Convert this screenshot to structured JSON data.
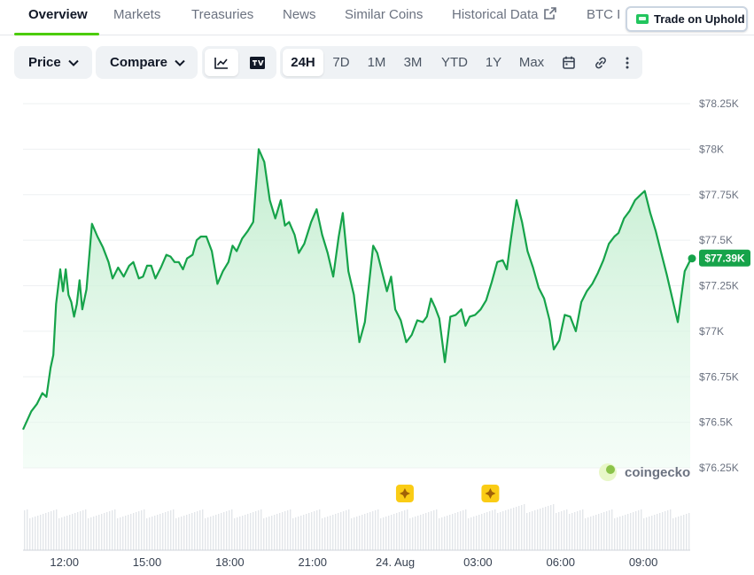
{
  "tabs": [
    {
      "label": "Overview",
      "active": true
    },
    {
      "label": "Markets"
    },
    {
      "label": "Treasuries"
    },
    {
      "label": "News"
    },
    {
      "label": "Similar Coins"
    },
    {
      "label": "Historical Data"
    },
    {
      "label": "BTC I"
    }
  ],
  "trade_button": {
    "label": "Trade on Uphold"
  },
  "toolbar": {
    "price_label": "Price",
    "compare_label": "Compare",
    "chart_type_icons": [
      "line-chart-icon",
      "tradingview-icon"
    ],
    "ranges": [
      "24H",
      "7D",
      "1M",
      "3M",
      "YTD",
      "1Y",
      "Max"
    ],
    "selected_range": "24H",
    "action_icons": [
      "calendar-icon",
      "link-icon",
      "more-icon"
    ]
  },
  "colors": {
    "accent": "#4bcc00",
    "line": "#16a34a",
    "fill": "#d6f5df",
    "event_marker": "#facc15"
  },
  "watermark": "coingecko",
  "current_price_label": "$77.39K",
  "chart_data": {
    "type": "area",
    "title": "",
    "xlabel": "",
    "ylabel": "",
    "ylim": [
      76180,
      78280
    ],
    "x_ticks": [
      "12:00",
      "15:00",
      "18:00",
      "21:00",
      "24. Aug",
      "03:00",
      "06:00",
      "09:00"
    ],
    "y_ticks": [
      "$78.25K",
      "$78K",
      "$77.75K",
      "$77.5K",
      "$77.25K",
      "$77K",
      "$76.75K",
      "$76.5K",
      "$76.25K"
    ],
    "grid": true,
    "x_hours": [
      0,
      0.3,
      0.5,
      0.7,
      0.85,
      1.0,
      1.1,
      1.2,
      1.35,
      1.45,
      1.55,
      1.65,
      1.75,
      1.85,
      1.95,
      2.05,
      2.15,
      2.3,
      2.5,
      2.7,
      2.9,
      3.1,
      3.25,
      3.45,
      3.65,
      3.85,
      4.0,
      4.2,
      4.35,
      4.5,
      4.65,
      4.8,
      5.0,
      5.2,
      5.35,
      5.5,
      5.65,
      5.8,
      5.95,
      6.15,
      6.3,
      6.45,
      6.65,
      6.85,
      7.05,
      7.25,
      7.45,
      7.6,
      7.75,
      7.95,
      8.15,
      8.35,
      8.55,
      8.75,
      8.95,
      9.15,
      9.35,
      9.5,
      9.65,
      9.85,
      10.0,
      10.2,
      10.45,
      10.65,
      10.85,
      11.05,
      11.25,
      11.45,
      11.6,
      11.8,
      12.0,
      12.2,
      12.4,
      12.55,
      12.7,
      12.85,
      13.0,
      13.2,
      13.35,
      13.5,
      13.7,
      13.9,
      14.1,
      14.3,
      14.5,
      14.65,
      14.8,
      14.95,
      15.1,
      15.3,
      15.5,
      15.7,
      15.9,
      16.05,
      16.2,
      16.4,
      16.6,
      16.8,
      17.0,
      17.2,
      17.4,
      17.55,
      17.7,
      17.9,
      18.1,
      18.3,
      18.5,
      18.7,
      18.9,
      19.1,
      19.25,
      19.45,
      19.65,
      19.85,
      20.05,
      20.25,
      20.45,
      20.65,
      20.85,
      21.05,
      21.25,
      21.45,
      21.6,
      21.8,
      22.0,
      22.2,
      22.4,
      22.55,
      22.75,
      22.95,
      23.15,
      23.35,
      23.55,
      23.75,
      24.0,
      24.2
    ],
    "values": [
      76460,
      76560,
      76600,
      76660,
      76640,
      76800,
      76870,
      77150,
      77340,
      77220,
      77340,
      77200,
      77160,
      77080,
      77150,
      77280,
      77120,
      77230,
      77590,
      77520,
      77460,
      77380,
      77290,
      77350,
      77300,
      77360,
      77380,
      77290,
      77300,
      77360,
      77360,
      77290,
      77350,
      77420,
      77410,
      77380,
      77380,
      77340,
      77400,
      77420,
      77500,
      77520,
      77520,
      77440,
      77260,
      77330,
      77380,
      77470,
      77440,
      77510,
      77550,
      77600,
      78000,
      77930,
      77720,
      77620,
      77720,
      77580,
      77600,
      77530,
      77430,
      77480,
      77600,
      77670,
      77530,
      77430,
      77300,
      77520,
      77650,
      77330,
      77200,
      76940,
      77050,
      77260,
      77470,
      77430,
      77340,
      77220,
      77300,
      77120,
      77060,
      76940,
      76980,
      77060,
      77050,
      77080,
      77180,
      77130,
      77070,
      76830,
      77080,
      77090,
      77120,
      77030,
      77080,
      77090,
      77120,
      77170,
      77270,
      77380,
      77390,
      77340,
      77510,
      77720,
      77600,
      77440,
      77350,
      77240,
      77180,
      77060,
      76900,
      76950,
      77090,
      77080,
      77000,
      77160,
      77220,
      77260,
      77320,
      77390,
      77480,
      77520,
      77540,
      77620,
      77660,
      77720,
      77750,
      77770,
      77650,
      77550,
      77430,
      77310,
      77180,
      77050,
      77330,
      77390
    ],
    "events_hours": [
      13.85,
      16.95
    ],
    "current_value": 77390
  }
}
